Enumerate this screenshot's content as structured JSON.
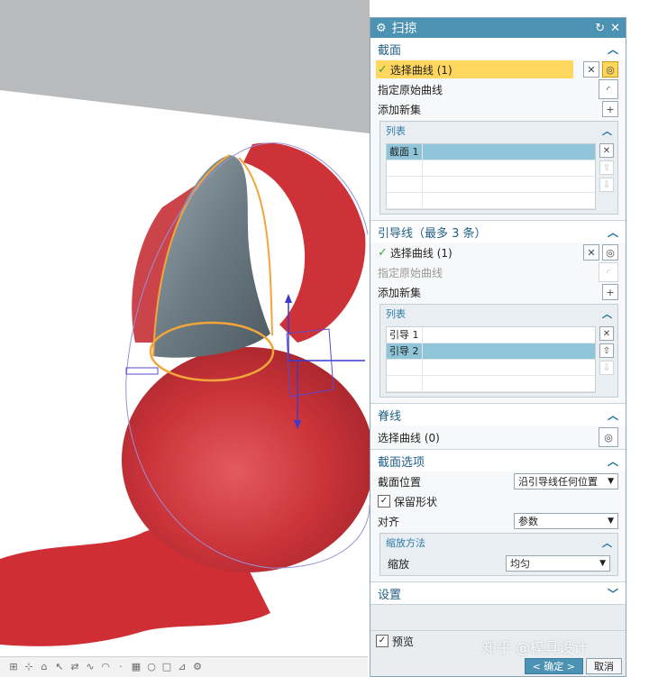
{
  "dialog": {
    "title": "扫掠",
    "title_icon": "gear-icon",
    "sections": {
      "section": {
        "title": "截面",
        "select_curve": "选择曲线 (1)",
        "specify_origin": "指定原始曲线",
        "add_new_set": "添加新集",
        "list_title": "列表",
        "list_items": [
          "截面 1"
        ]
      },
      "guide": {
        "title": "引导线（最多 3 条）",
        "select_curve": "选择曲线 (1)",
        "specify_origin": "指定原始曲线",
        "add_new_set": "添加新集",
        "list_title": "列表",
        "list_items": [
          "引导 1",
          "引导 2"
        ]
      },
      "spine": {
        "title": "脊线",
        "select_curve": "选择曲线 (0)"
      },
      "options": {
        "title": "截面选项",
        "position_label": "截面位置",
        "position_value": "沿引导线任何位置",
        "keep_shape": "保留形状",
        "align_label": "对齐",
        "align_value": "参数",
        "scaling_title": "缩放方法",
        "scale_label": "缩放",
        "scale_value": "均匀"
      },
      "settings": {
        "title": "设置"
      }
    },
    "preview_label": "预览",
    "ok_label": "< 确定 >",
    "cancel_label": "取消"
  },
  "watermark": "知乎 @模具设计",
  "colors": {
    "title_bar": "#4b92b3",
    "selection": "#ffd75e",
    "list_selected": "#8fc4d9",
    "claw_red": "#c9333a",
    "surface_gray": "#6f7f88"
  }
}
